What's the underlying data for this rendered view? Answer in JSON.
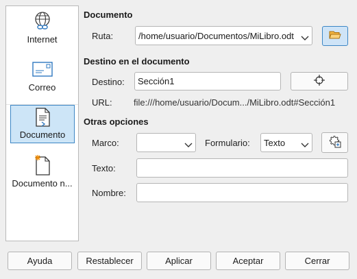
{
  "sidebar": {
    "items": [
      {
        "label": "Internet",
        "icon": "globe-link-icon"
      },
      {
        "label": "Correo",
        "icon": "envelope-icon"
      },
      {
        "label": "Documento",
        "icon": "document-icon",
        "selected": true
      },
      {
        "label": "Documento n...",
        "icon": "new-document-icon"
      }
    ]
  },
  "document": {
    "title": "Documento",
    "path_label": "Ruta:",
    "path_value": "/home/usuario/Documentos/MiLibro.odt",
    "folder_icon": "folder-open-icon"
  },
  "target": {
    "title": "Destino en el documento",
    "target_label": "Destino:",
    "target_value": "Sección1",
    "target_button_icon": "target-crosshair-icon",
    "url_label": "URL:",
    "url_value": "file:///home/usuario/Docum.../MiLibro.odt#Sección1"
  },
  "options": {
    "title": "Otras opciones",
    "frame_label": "Marco:",
    "frame_value": "",
    "form_label": "Formulario:",
    "form_value": "Texto",
    "events_icon": "events-macro-icon",
    "text_label": "Texto:",
    "text_value": "",
    "name_label": "Nombre:",
    "name_value": ""
  },
  "buttons": {
    "help": "Ayuda",
    "reset": "Restablecer",
    "apply": "Aplicar",
    "ok": "Aceptar",
    "close": "Cerrar"
  },
  "colors": {
    "accent": "#3b85c4",
    "selected_bg": "#cde5f7"
  }
}
